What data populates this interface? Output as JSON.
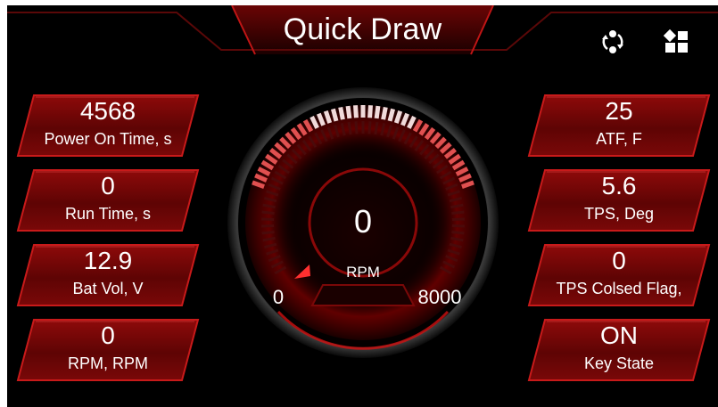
{
  "header": {
    "title": "Quick Draw"
  },
  "icons": {
    "swap": "cycle-arrows-icon",
    "layout": "grid-layout-icon"
  },
  "left_tiles": [
    {
      "value": "4568",
      "label": "Power On Time, s"
    },
    {
      "value": "0",
      "label": "Run Time, s"
    },
    {
      "value": "12.9",
      "label": "Bat Vol, V"
    },
    {
      "value": "0",
      "label": "RPM, RPM"
    }
  ],
  "right_tiles": [
    {
      "value": "25",
      "label": "ATF, F"
    },
    {
      "value": "5.6",
      "label": "TPS, Deg"
    },
    {
      "value": "0",
      "label": "TPS Colsed Flag,"
    },
    {
      "value": "ON",
      "label": "Key State"
    }
  ],
  "gauge": {
    "value": "0",
    "unit": "RPM",
    "min": "0",
    "max": "8000",
    "level": 0
  },
  "colors": {
    "background": "#000000",
    "accent_red": "#b01010",
    "tile_red": "#7a0707",
    "text": "#ffffff"
  }
}
